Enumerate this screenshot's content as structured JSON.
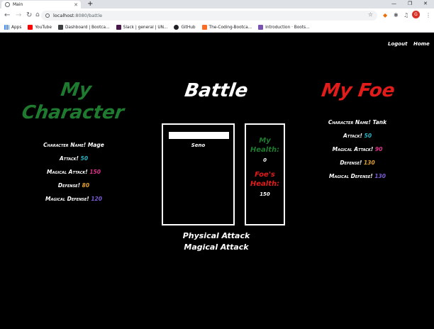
{
  "browser": {
    "tab_title": "Main",
    "url_host": "localhost",
    "url_path": ":8080/battle",
    "profile_initial": "G",
    "bookmarks": [
      {
        "label": "Apps",
        "color": "#4285f4"
      },
      {
        "label": "YouTube",
        "color": "#ff0000"
      },
      {
        "label": "Dashboard | Bootca...",
        "color": "#3c4043"
      },
      {
        "label": "Slack | general | UN...",
        "color": "#4a154b"
      },
      {
        "label": "GitHub",
        "color": "#202124"
      },
      {
        "label": "The-Coding-Bootca...",
        "color": "#fc6d26"
      },
      {
        "label": "Introduction · Boots...",
        "color": "#7952b3"
      }
    ]
  },
  "nav": {
    "logout": "Logout",
    "home": "Home"
  },
  "my_character": {
    "heading_line1": "My",
    "heading_line2": "Character",
    "heading_color": "#1e7a2e",
    "stats": [
      {
        "label": "Character Name!",
        "value": "Mage",
        "color": "#ffffff"
      },
      {
        "label": "Attack!",
        "value": "50",
        "color": "#2bb3c0"
      },
      {
        "label": "Magical Attack!",
        "value": "150",
        "color": "#e0308a"
      },
      {
        "label": "Defense!",
        "value": "80",
        "color": "#e0a030"
      },
      {
        "label": "Magical Defense!",
        "value": "120",
        "color": "#7b5bd6"
      }
    ]
  },
  "battle": {
    "heading": "Battle",
    "log_text": "Seno",
    "my_health_label_1": "My",
    "my_health_label_2": "Health:",
    "my_health_value": "0",
    "my_health_color": "#1e7a2e",
    "foe_health_label_1": "Foe's",
    "foe_health_label_2": "Health:",
    "foe_health_value": "150",
    "foe_health_color": "#e21b1b",
    "physical_attack": "Physical Attack",
    "magical_attack": "Magical Attack"
  },
  "my_foe": {
    "heading": "My Foe",
    "heading_color": "#e21b1b",
    "stats": [
      {
        "label": "Character Name!",
        "value": "Tank",
        "color": "#ffffff"
      },
      {
        "label": "Attack!",
        "value": "50",
        "color": "#2bb3c0"
      },
      {
        "label": "Magical Attack!",
        "value": "90",
        "color": "#e0308a"
      },
      {
        "label": "Defense!",
        "value": "130",
        "color": "#e0a030"
      },
      {
        "label": "Magical Defense!",
        "value": "130",
        "color": "#7b5bd6"
      }
    ]
  }
}
